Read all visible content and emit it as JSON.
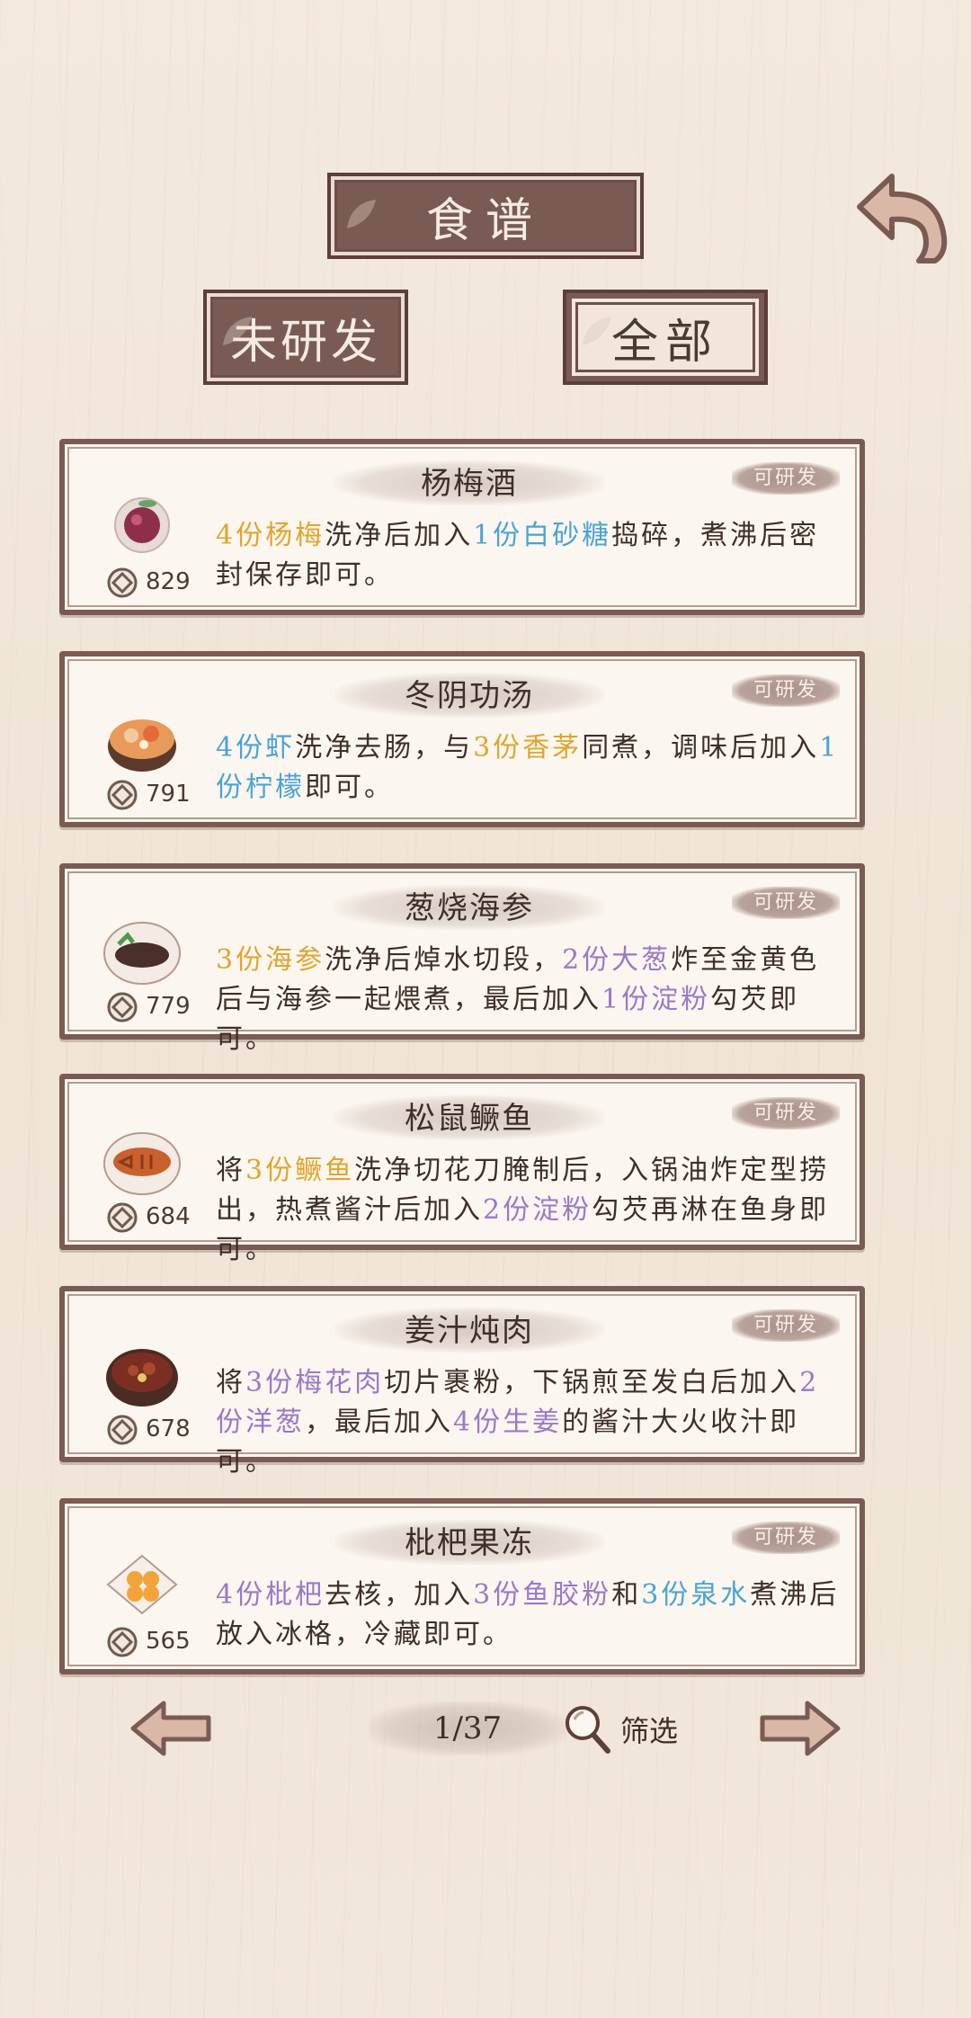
{
  "header": {
    "title": "食谱",
    "back_icon": "back-arrow-icon"
  },
  "filters": {
    "undeveloped": "未研发",
    "all": "全部"
  },
  "recipes": [
    {
      "name": "杨梅酒",
      "badge": "可研发",
      "cost": "829",
      "dish_icon": "bayberry-wine-icon",
      "desc": [
        {
          "t": "4份杨梅",
          "c": "y"
        },
        {
          "t": "洗净后加入"
        },
        {
          "t": "1份白砂糖",
          "c": "b"
        },
        {
          "t": "捣碎，煮沸后密封保存即可。"
        }
      ]
    },
    {
      "name": "冬阴功汤",
      "badge": "可研发",
      "cost": "791",
      "dish_icon": "tom-yum-soup-icon",
      "desc": [
        {
          "t": "4份虾",
          "c": "b"
        },
        {
          "t": "洗净去肠，与"
        },
        {
          "t": "3份香茅",
          "c": "y"
        },
        {
          "t": "同煮，调味后加入"
        },
        {
          "t": "1份柠檬",
          "c": "b"
        },
        {
          "t": "即可。"
        }
      ]
    },
    {
      "name": "葱烧海参",
      "badge": "可研发",
      "cost": "779",
      "dish_icon": "sea-cucumber-icon",
      "desc": [
        {
          "t": "3份海参",
          "c": "y"
        },
        {
          "t": "洗净后焯水切段，"
        },
        {
          "t": "2份大葱",
          "c": "p"
        },
        {
          "t": "炸至金黄色后与海参一起煨煮，最后加入"
        },
        {
          "t": "1份淀粉",
          "c": "p"
        },
        {
          "t": "勾芡即可。"
        }
      ]
    },
    {
      "name": "松鼠鳜鱼",
      "badge": "可研发",
      "cost": "684",
      "dish_icon": "squirrel-fish-icon",
      "desc": [
        {
          "t": "将"
        },
        {
          "t": "3份鳜鱼",
          "c": "y"
        },
        {
          "t": "洗净切花刀腌制后，入锅油炸定型捞出，热煮酱汁后加入"
        },
        {
          "t": "2份淀粉",
          "c": "p"
        },
        {
          "t": "勾芡再淋在鱼身即可。"
        }
      ]
    },
    {
      "name": "姜汁炖肉",
      "badge": "可研发",
      "cost": "678",
      "dish_icon": "braised-pork-icon",
      "desc": [
        {
          "t": "将"
        },
        {
          "t": "3份梅花肉",
          "c": "p"
        },
        {
          "t": "切片裹粉，下锅煎至发白后加入"
        },
        {
          "t": "2份洋葱",
          "c": "p"
        },
        {
          "t": "，最后加入"
        },
        {
          "t": "4份生姜",
          "c": "p"
        },
        {
          "t": "的酱汁大火收汁即可。"
        }
      ]
    },
    {
      "name": "枇杷果冻",
      "badge": "可研发",
      "cost": "565",
      "dish_icon": "loquat-jelly-icon",
      "desc": [
        {
          "t": "4份枇杷",
          "c": "p"
        },
        {
          "t": "去核，加入"
        },
        {
          "t": "3份鱼胶粉",
          "c": "p"
        },
        {
          "t": "和"
        },
        {
          "t": "3份泉水",
          "c": "b"
        },
        {
          "t": "煮沸后放入冰格，冷藏即可。"
        }
      ]
    }
  ],
  "pagination": {
    "page": "1/37",
    "filter_label": "筛选",
    "prev_icon": "prev-arrow-icon",
    "next_icon": "next-arrow-icon",
    "search_icon": "magnifier-icon"
  },
  "colors": {
    "yellow": "#e0a52e",
    "blue": "#4aa3d6",
    "purple": "#9a78c9",
    "frame": "#7a5b53"
  }
}
